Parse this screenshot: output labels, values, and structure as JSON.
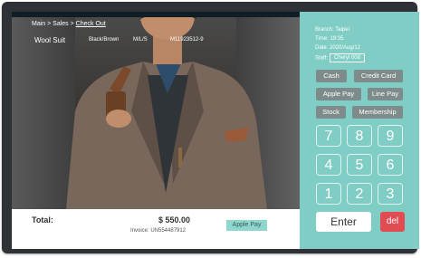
{
  "breadcrumb": {
    "part1": "Main",
    "sep1": " > ",
    "part2": "Sales",
    "sep2": " > ",
    "current": "Check Out"
  },
  "item": {
    "name": "Wool Suit",
    "color": "Black/Brown",
    "size": "M/L/S",
    "code": "M11923512-9"
  },
  "total": {
    "label": "Total:",
    "amount": "$ 550.00",
    "invoice": "Invoice: UN554487912",
    "payment_badge": "Apple Pay"
  },
  "info": {
    "branch": "Branch: Taipei",
    "time": "Time: 19:35",
    "date": "Date: 2020/Aug/12",
    "staff_label": "Staff:",
    "staff_value": "Cheryl 008"
  },
  "payment_buttons": {
    "cash": "Cash",
    "credit_card": "Credit Card",
    "apple_pay": "Apple Pay",
    "line_pay": "Line Pay",
    "stock": "Stock",
    "membership": "Membership"
  },
  "keypad": {
    "k7": "7",
    "k8": "8",
    "k9": "9",
    "k4": "4",
    "k5": "5",
    "k6": "6",
    "k1": "1",
    "k2": "2",
    "k3": "3"
  },
  "actions": {
    "enter": "Enter",
    "del": "del"
  },
  "colors": {
    "panel": "#7fcdc4",
    "button": "#7e8b8b",
    "delete": "#e14c52",
    "frame": "#2e3136"
  }
}
